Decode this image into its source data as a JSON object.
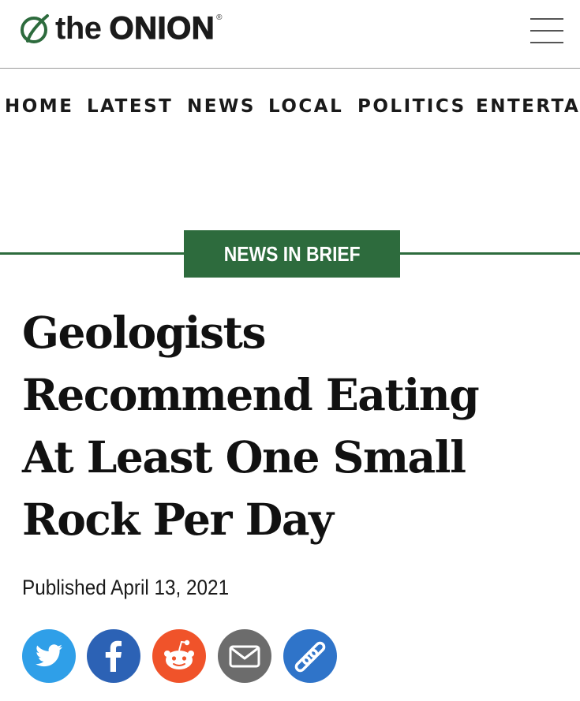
{
  "brand": {
    "the": "the",
    "name": "ONION",
    "reg": "®"
  },
  "nav": [
    "HOME",
    "LATEST",
    "NEWS",
    "LOCAL",
    "POLITICS",
    "ENTERTAIN"
  ],
  "section_tag": "NEWS IN BRIEF",
  "headline_lines": [
    "Geologists",
    "Recommend Eating",
    "At Least One Small",
    "Rock Per Day"
  ],
  "published": "Published April 13, 2021",
  "share_icons": [
    "twitter-icon",
    "facebook-icon",
    "reddit-icon",
    "email-icon",
    "link-icon"
  ],
  "colors": {
    "brand_green": "#2d6b3d",
    "twitter": "#2f9fe8",
    "facebook": "#2c62b5",
    "reddit": "#f0532a",
    "email": "#6c6c6c",
    "link": "#2f74c9"
  }
}
